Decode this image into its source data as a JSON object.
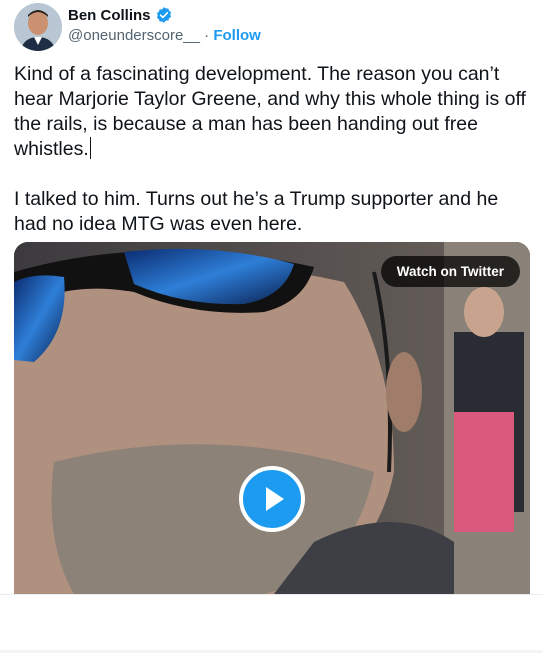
{
  "author": {
    "name": "Ben Collins",
    "handle": "@oneunderscore__",
    "separator": "·",
    "follow_label": "Follow"
  },
  "tweet": {
    "paragraph1": "Kind of a fascinating development. The reason you can’t hear Marjorie Taylor Greene, and why this whole thing is off the rails, is because a man has been handing out free whistles.",
    "paragraph2": "I talked to him. Turns out he’s a Trump supporter and he had no idea MTG was even here."
  },
  "media": {
    "watch_label": "Watch on Twitter",
    "play_icon": "play-icon"
  },
  "icons": {
    "verified": "verified-badge-icon"
  },
  "colors": {
    "accent": "#1d9bf0",
    "text": "#0f1419",
    "muted": "#536471"
  }
}
